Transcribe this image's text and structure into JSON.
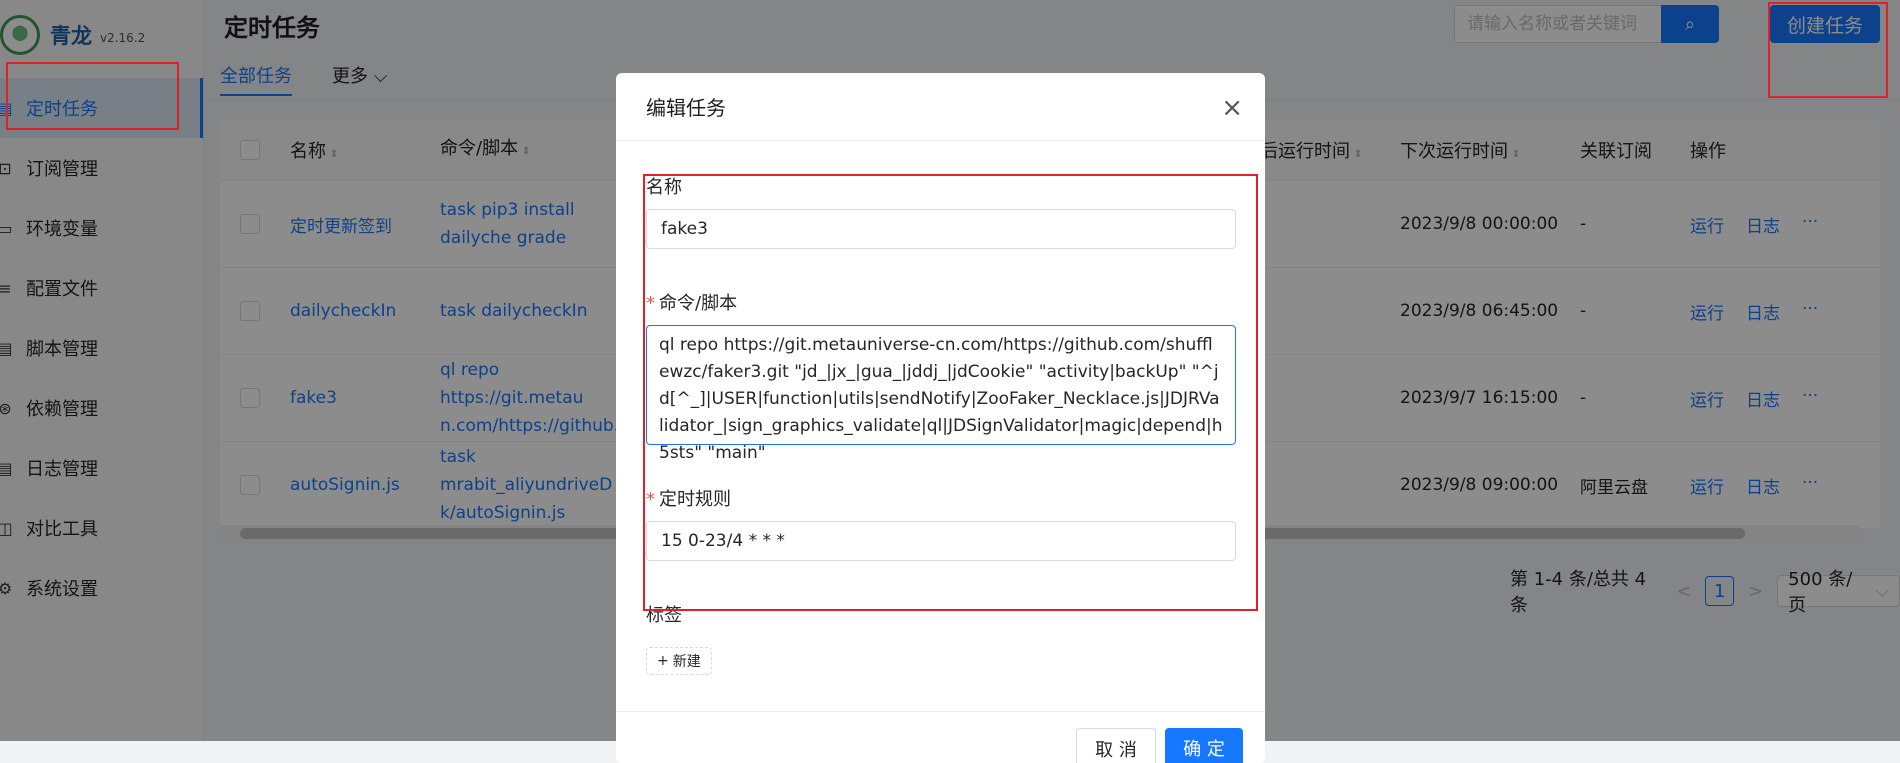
{
  "app": {
    "name": "青龙",
    "version": "v2.16.2"
  },
  "sidebar": {
    "items": [
      {
        "label": "定时任务",
        "icon": "calendar-icon",
        "glyph": "▤"
      },
      {
        "label": "订阅管理",
        "icon": "subscribe-icon",
        "glyph": "⊡"
      },
      {
        "label": "环境变量",
        "icon": "monitor-icon",
        "glyph": "▭"
      },
      {
        "label": "配置文件",
        "icon": "sliders-icon",
        "glyph": "≡"
      },
      {
        "label": "脚本管理",
        "icon": "file-icon",
        "glyph": "▤"
      },
      {
        "label": "依赖管理",
        "icon": "deps-icon",
        "glyph": "⊛"
      },
      {
        "label": "日志管理",
        "icon": "log-icon",
        "glyph": "▤"
      },
      {
        "label": "对比工具",
        "icon": "diff-icon",
        "glyph": "◫"
      },
      {
        "label": "系统设置",
        "icon": "gear-icon",
        "glyph": "⚙"
      }
    ]
  },
  "header": {
    "title": "定时任务",
    "search_placeholder": "请输入名称或者关键词",
    "search_icon": "⌕",
    "create_label": "创建任务"
  },
  "tabs": {
    "all": "全部任务",
    "more": "更多",
    "more_icon": "⌵"
  },
  "table": {
    "columns": {
      "name": "名称",
      "command": "命令/脚本",
      "last_run": "后运行时间",
      "next_run": "下次运行时间",
      "subscription": "关联订阅",
      "actions": "操作"
    },
    "sort_icon": "⇕",
    "rows": [
      {
        "name": "定时更新签到",
        "command": "task pip3 install dailyche grade",
        "next_run": "2023/9/8 00:00:00",
        "subscription": "-",
        "run": "运行",
        "log": "日志",
        "more": "···"
      },
      {
        "name": "dailycheckIn",
        "command": "task dailycheckIn",
        "next_run": "2023/9/8 06:45:00",
        "subscription": "-",
        "run": "运行",
        "log": "日志",
        "more": "···"
      },
      {
        "name": "fake3",
        "command": "ql repo https://git.metau n.com/https://github.co",
        "next_run": "2023/9/7 16:15:00",
        "subscription": "-",
        "run": "运行",
        "log": "日志",
        "more": "···"
      },
      {
        "name": "autoSignin.js",
        "command": "task mrabit_aliyundriveD k/autoSignin.js",
        "next_run": "2023/9/8 09:00:00",
        "subscription": "阿里云盘",
        "run": "运行",
        "log": "日志",
        "more": "···"
      }
    ]
  },
  "pagination": {
    "summary": "第 1-4 条/总共 4 条",
    "prev": "<",
    "page": "1",
    "next": ">",
    "page_size": "500 条/页",
    "page_size_icon": "⌵"
  },
  "modal": {
    "title": "编辑任务",
    "close": "×",
    "fields": {
      "name_label": "名称",
      "name_value": "fake3",
      "command_label": "命令/脚本",
      "command_value": "ql repo https://git.metauniverse-cn.com/https://github.com/shufflewzc/faker3.git \"jd_|jx_|gua_|jddj_|jdCookie\" \"activity|backUp\" \"^jd[^_]|USER|function|utils|sendNotify|ZooFaker_Necklace.js|JDJRValidator_|sign_graphics_validate|ql|JDSignValidator|magic|depend|h5sts\" \"main\"",
      "schedule_label": "定时规则",
      "schedule_value": "15 0-23/4 * * *",
      "tags_label": "标签",
      "new_tag": "新建",
      "required_mark": "*",
      "plus": "+"
    },
    "cancel": "取 消",
    "ok": "确 定"
  },
  "colors": {
    "primary": "#1677ff",
    "highlight": "#e0202a",
    "required": "#ff4d4f"
  }
}
